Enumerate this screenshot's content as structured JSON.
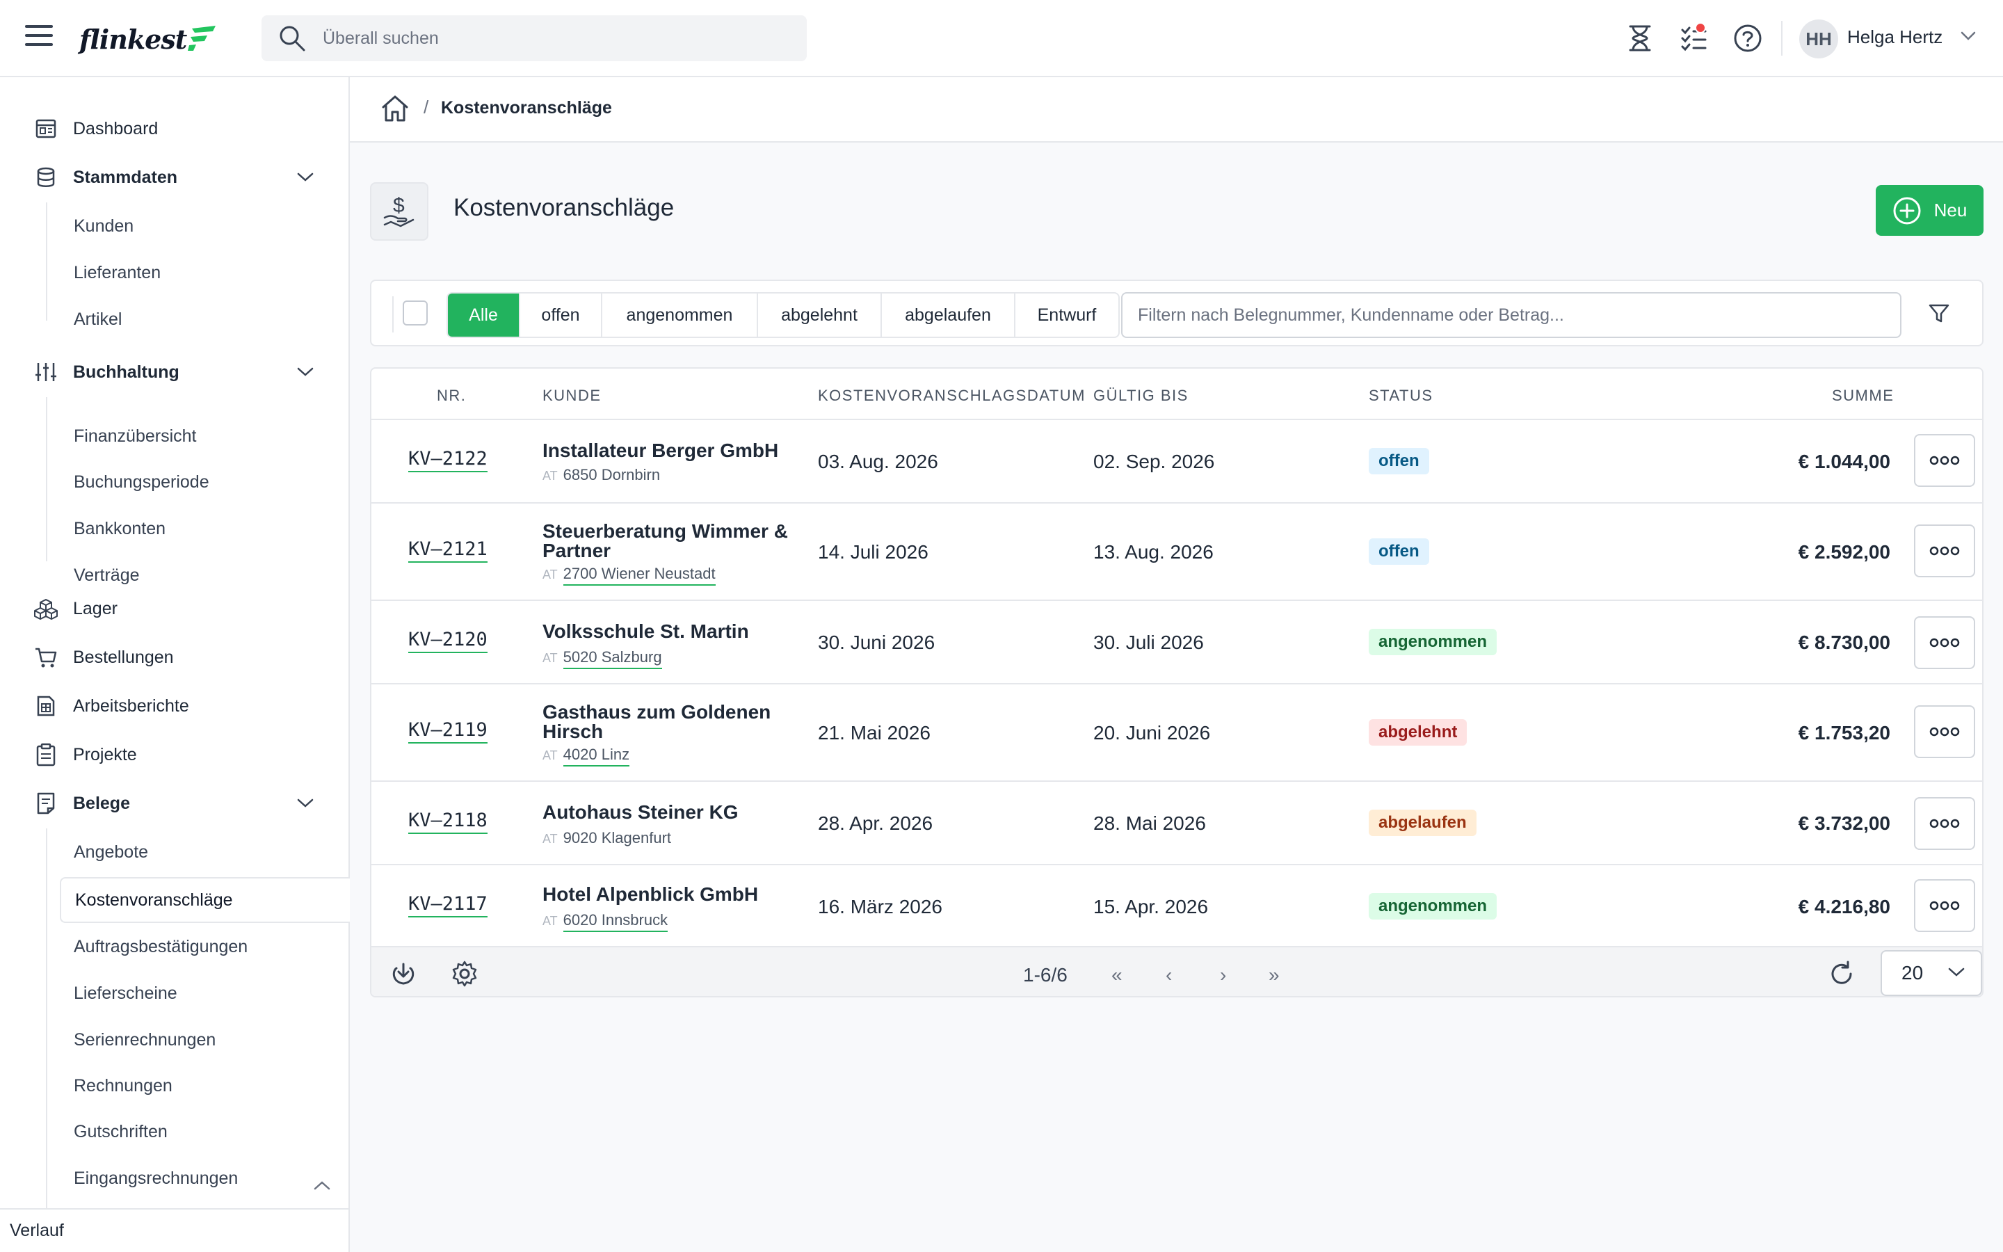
{
  "app": {
    "logo_text": "flinkest"
  },
  "search": {
    "placeholder": "Überall suchen"
  },
  "user": {
    "initials": "HH",
    "name": "Helga Hertz"
  },
  "sidebar": {
    "items": [
      {
        "label": "Dashboard",
        "icon": "dashboard-icon"
      },
      {
        "label": "Stammdaten",
        "icon": "database-icon",
        "expanded": true,
        "children": [
          "Kunden",
          "Lieferanten",
          "Artikel"
        ]
      },
      {
        "label": "Buchhaltung",
        "icon": "sliders-icon",
        "expanded": true,
        "children": [
          "Finanzübersicht",
          "Buchungsperiode",
          "Bankkonten",
          "Verträge"
        ]
      },
      {
        "label": "Lager",
        "icon": "boxes-icon"
      },
      {
        "label": "Bestellungen",
        "icon": "cart-icon"
      },
      {
        "label": "Arbeitsberichte",
        "icon": "report-icon"
      },
      {
        "label": "Projekte",
        "icon": "clipboard-icon"
      },
      {
        "label": "Belege",
        "icon": "document-icon",
        "expanded": true,
        "children": [
          "Angebote",
          "Kostenvoranschläge",
          "Auftragsbestätigungen",
          "Lieferscheine",
          "Serienrechnungen",
          "Rechnungen",
          "Gutschriften",
          "Eingangsrechnungen"
        ]
      }
    ],
    "active_item": "Kostenvoranschläge",
    "footer_label": "Verlauf"
  },
  "breadcrumb": {
    "current": "Kostenvoranschläge",
    "separator": "/"
  },
  "page": {
    "title": "Kostenvoranschläge",
    "new_button_label": "Neu"
  },
  "filters": {
    "tabs": [
      "Alle",
      "offen",
      "angenommen",
      "abgelehnt",
      "abgelaufen",
      "Entwurf"
    ],
    "active_tab": "Alle",
    "input_placeholder": "Filtern nach Belegnummer, Kundenname oder Betrag..."
  },
  "table": {
    "columns": [
      "NR.",
      "KUNDE",
      "KOSTENVORANSCHLAGSDATUM",
      "GÜLTIG BIS",
      "STATUS",
      "SUMME"
    ],
    "rows": [
      {
        "nr": "KV–2122",
        "kunde": "Installateur Berger GmbH",
        "country": "AT",
        "ort": "6850 Dornbirn",
        "datum": "03. Aug. 2026",
        "gueltig": "02. Sep. 2026",
        "status": "offen",
        "summe": "€ 1.044,00"
      },
      {
        "nr": "KV–2121",
        "kunde": "Steuerberatung Wimmer & Partner",
        "country": "AT",
        "ort": "2700 Wiener Neustadt",
        "datum": "14. Juli 2026",
        "gueltig": "13. Aug. 2026",
        "status": "offen",
        "summe": "€ 2.592,00"
      },
      {
        "nr": "KV–2120",
        "kunde": "Volksschule St. Martin",
        "country": "AT",
        "ort": "5020 Salzburg",
        "datum": "30. Juni 2026",
        "gueltig": "30. Juli 2026",
        "status": "angenommen",
        "summe": "€ 8.730,00"
      },
      {
        "nr": "KV–2119",
        "kunde": "Gasthaus zum Goldenen Hirsch",
        "country": "AT",
        "ort": "4020 Linz",
        "datum": "21. Mai 2026",
        "gueltig": "20. Juni 2026",
        "status": "abgelehnt",
        "summe": "€ 1.753,20"
      },
      {
        "nr": "KV–2118",
        "kunde": "Autohaus Steiner KG",
        "country": "AT",
        "ort": "9020 Klagenfurt",
        "datum": "28. Apr. 2026",
        "gueltig": "28. Mai 2026",
        "status": "abgelaufen",
        "summe": "€ 3.732,00"
      },
      {
        "nr": "KV–2117",
        "kunde": "Hotel Alpenblick GmbH",
        "country": "AT",
        "ort": "6020 Innsbruck",
        "datum": "16. März 2026",
        "gueltig": "15. Apr. 2026",
        "status": "angenommen",
        "summe": "€ 4.216,80"
      }
    ]
  },
  "pagination": {
    "range_text": "1-6/6",
    "page_size": "20",
    "first": "«",
    "prev": "‹",
    "next": "›",
    "last": "»"
  },
  "colors": {
    "accent": "#22b35e",
    "offen": "#e0f2fe",
    "angenommen": "#dcfce7",
    "abgelehnt": "#fee2e2",
    "abgelaufen": "#ffedd5"
  }
}
